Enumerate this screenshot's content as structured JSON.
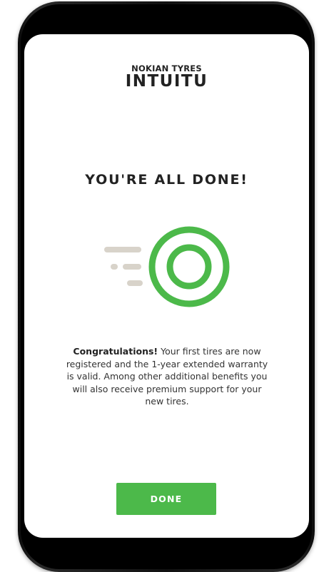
{
  "brand": {
    "top_line": "NOKIAN TYRES",
    "main_line": "INTUITU"
  },
  "title": "YOU'RE ALL DONE!",
  "illustration": {
    "icon": "target-check-icon",
    "ring_color": "#4cb94a",
    "speed_lines_color": "#d8d3ca"
  },
  "message": {
    "bold": "Congratulations!",
    "body": " Your first tires are now registered and the 1-year extended warranty is valid. Among other additional benefits you will also receive premium support for your new tires."
  },
  "actions": {
    "done_label": "DONE",
    "accent_color": "#4cb94a"
  }
}
